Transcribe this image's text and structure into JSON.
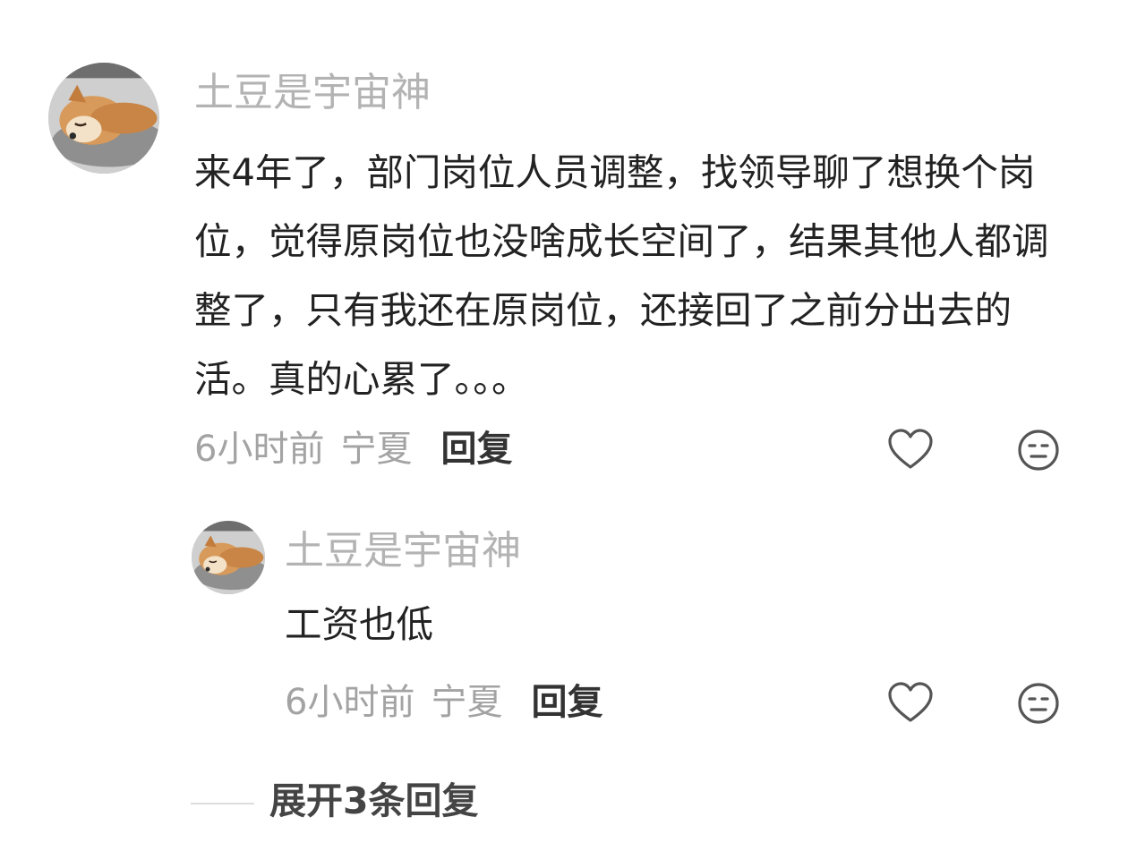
{
  "colors": {
    "background": "#ffffff",
    "username": "#b3b3b3",
    "body_text": "#222222",
    "meta_text": "#a3a3a3",
    "reply_link": "#333333",
    "icon_stroke": "#555555",
    "divider": "#dddddd"
  },
  "comment": {
    "avatar_icon": "shiba-dog-avatar",
    "username": "土豆是宇宙神",
    "content": "来4年了，部门岗位人员调整，找领导聊了想换个岗位，觉得原岗位也没啥成长空间了，结果其他人都调整了，只有我还在原岗位，还接回了之前分出去的活。真的心累了。。。",
    "time": "6小时前",
    "region": "宁夏",
    "reply_label": "回复",
    "like_icon": "heart-outline-icon",
    "dislike_icon": "neutral-face-icon"
  },
  "reply": {
    "avatar_icon": "shiba-dog-avatar",
    "username": "土豆是宇宙神",
    "content": "工资也低",
    "time": "6小时前",
    "region": "宁夏",
    "reply_label": "回复",
    "like_icon": "heart-outline-icon",
    "dislike_icon": "neutral-face-icon"
  },
  "expand_replies": {
    "label": "展开3条回复"
  }
}
